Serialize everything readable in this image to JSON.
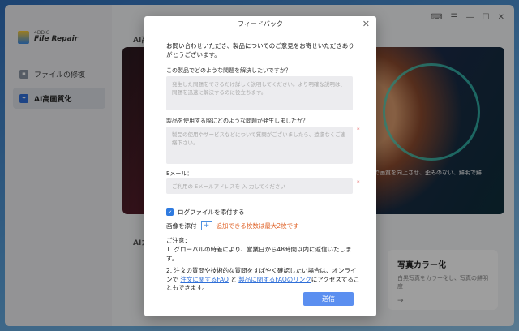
{
  "app": {
    "logo_small": "4DDiG",
    "logo_big": "File Repair"
  },
  "sidebar": {
    "items": [
      {
        "label": "ファイルの修復"
      },
      {
        "label": "AI高画質化"
      }
    ]
  },
  "main": {
    "section_top": "AI高",
    "section_bottom": "AIカ",
    "hero_text": "で画質を向上させ、歪みのない、鮮明で鮮",
    "card2": {
      "title": "写真カラー化",
      "desc": "白黒写真をカラー化し、写真の鮮明度",
      "arrow": "→"
    }
  },
  "dialog": {
    "title": "フィードバック",
    "intro": "お問い合わせいただき、製品についてのご意見をお寄せいただきありがとうございます。",
    "q1": {
      "label": "この製品でどのような問題を解決したいですか？",
      "placeholder": "発生した問題をできるだけ詳しく説明してください。より明確な説明は、問題を迅速に解決するのに役立ちます。"
    },
    "q2": {
      "label": "製品を使用する際にどのような問題が発生しましたか？",
      "placeholder": "製品の使用やサービスなどについて質問がございましたら、遠慮なくご連絡下さい。"
    },
    "email": {
      "label": "Eメール：",
      "placeholder": "ご利用の Eメールアドレスを 入 力してください"
    },
    "required_mark": "*",
    "attach_log": "ログファイルを添付する",
    "attach_image_label": "画像を添付",
    "attach_plus": "+",
    "attach_warn": "追加できる枚数は最大2枚です",
    "notes": {
      "title": "ご注意：",
      "line1": "1. グローバルの時差により、営業日から48時間以内に返信いたします。",
      "line2_a": "2. 注文の質問や技術的な質問をすばやく確認したい場合は、オンラインで",
      "link1": "注文に関するFAQ",
      "and": "と",
      "link2": "製品に関するFAQのリンク",
      "line2_b": "にアクセスすることもできます。"
    },
    "send": "送信",
    "close": "✕"
  },
  "titlebar": {
    "icons": [
      "⌨",
      "☰",
      "—",
      "☐",
      "✕"
    ]
  }
}
